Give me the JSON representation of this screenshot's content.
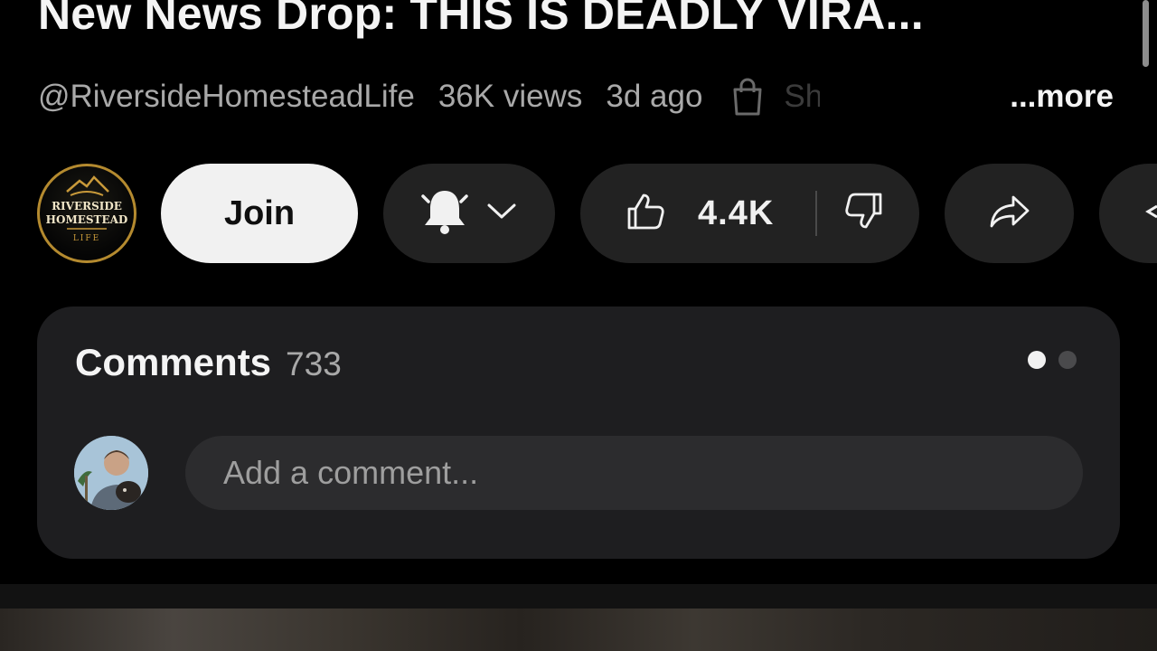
{
  "video": {
    "title": "New News Drop: THIS IS DEADLY VIRA...",
    "channel_handle": "@RiversideHomesteadLife",
    "views": "36K views",
    "age": "3d ago",
    "shop_label": "Sh",
    "more_label": "...more"
  },
  "channel": {
    "logo_line1": "RIVERSIDE",
    "logo_line2": "HOMESTEAD",
    "logo_line3": "LIFE"
  },
  "actions": {
    "join_label": "Join",
    "like_count": "4.4K"
  },
  "comments": {
    "title": "Comments",
    "count": "733",
    "placeholder": "Add a comment..."
  },
  "icons": {
    "shop": "shopping-bag-icon",
    "bell": "bell-icon",
    "chevron": "chevron-down-icon",
    "like": "thumbs-up-icon",
    "dislike": "thumbs-down-icon",
    "share": "share-icon"
  },
  "colors": {
    "background": "#000000",
    "card": "#1e1e20",
    "pill": "#222222",
    "join_button": "#f1f1f1",
    "logo_gold": "#b48a2f"
  }
}
